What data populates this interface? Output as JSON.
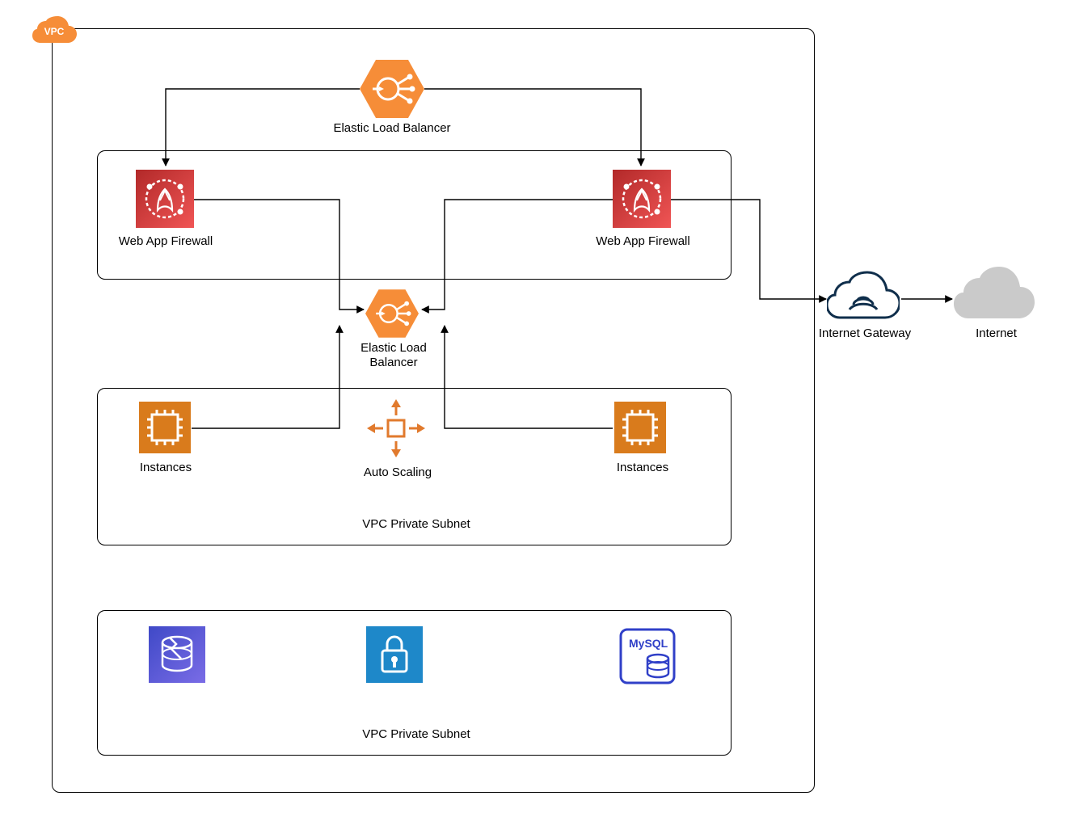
{
  "vpc": {
    "badge_text": "VPC"
  },
  "nodes": {
    "elb_top": {
      "label": "Elastic Load Balancer"
    },
    "waf_left": {
      "label": "Web App Firewall"
    },
    "waf_right": {
      "label": "Web App Firewall"
    },
    "elb_mid": {
      "label": "Elastic Load\nBalancer"
    },
    "instances_left": {
      "label": "Instances"
    },
    "autoscale": {
      "label": "Auto Scaling"
    },
    "instances_right": {
      "label": "Instances"
    },
    "subnet_mid": {
      "label": "VPC Private Subnet"
    },
    "subnet_bottom": {
      "label": "VPC Private Subnet"
    },
    "igw": {
      "label": "Internet Gateway"
    },
    "internet": {
      "label": "Internet"
    },
    "mysql": {
      "label": "MySQL"
    }
  },
  "colors": {
    "aws_orange": "#E17A2D",
    "aws_orange_light": "#F68D38",
    "aws_red1": "#D13B3B",
    "aws_red2": "#EE4C4C",
    "aws_blue": "#2E73B8",
    "aws_purple_blue": "#4B63C9",
    "aws_violet": "#5D4BCE",
    "cloud_fill": "#CACACA",
    "cloud_outline": "#0F2E4B"
  }
}
